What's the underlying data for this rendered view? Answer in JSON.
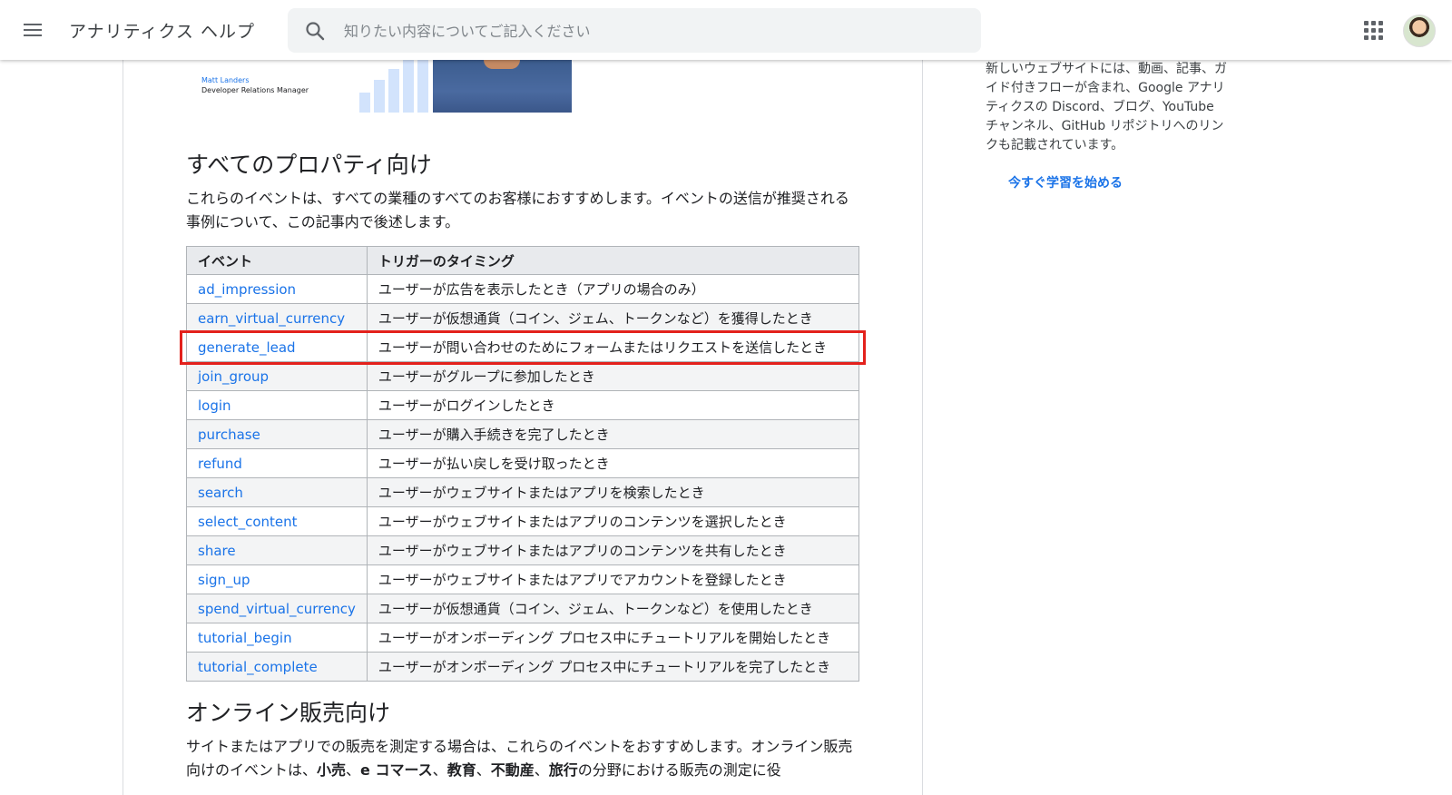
{
  "header": {
    "menu_icon": "menu-icon",
    "title": "アナリティクス ヘルプ",
    "search_placeholder": "知りたい内容についてご記入ください",
    "search_icon": "search-icon",
    "apps_icon": "apps-grid-icon",
    "avatar": "account-avatar"
  },
  "video": {
    "presenter_name": "Matt Landers",
    "presenter_role": "Developer Relations Manager"
  },
  "section_all": {
    "title": "すべてのプロパティ向け",
    "description": "これらのイベントは、すべての業種のすべてのお客様におすすめします。イベントの送信が推奨される事例について、この記事内で後述します。"
  },
  "table": {
    "headers": [
      "イベント",
      "トリガーのタイミング"
    ],
    "rows": [
      {
        "event": "ad_impression",
        "trigger": "ユーザーが広告を表示したとき（アプリの場合のみ）"
      },
      {
        "event": "earn_virtual_currency",
        "trigger": "ユーザーが仮想通貨（コイン、ジェム、トークンなど）を獲得したとき"
      },
      {
        "event": "generate_lead",
        "trigger": "ユーザーが問い合わせのためにフォームまたはリクエストを送信したとき"
      },
      {
        "event": "join_group",
        "trigger": "ユーザーがグループに参加したとき"
      },
      {
        "event": "login",
        "trigger": "ユーザーがログインしたとき"
      },
      {
        "event": "purchase",
        "trigger": "ユーザーが購入手続きを完了したとき"
      },
      {
        "event": "refund",
        "trigger": "ユーザーが払い戻しを受け取ったとき"
      },
      {
        "event": "search",
        "trigger": "ユーザーがウェブサイトまたはアプリを検索したとき"
      },
      {
        "event": "select_content",
        "trigger": "ユーザーがウェブサイトまたはアプリのコンテンツを選択したとき"
      },
      {
        "event": "share",
        "trigger": "ユーザーがウェブサイトまたはアプリのコンテンツを共有したとき"
      },
      {
        "event": "sign_up",
        "trigger": "ユーザーがウェブサイトまたはアプリでアカウントを登録したとき"
      },
      {
        "event": "spend_virtual_currency",
        "trigger": "ユーザーが仮想通貨（コイン、ジェム、トークンなど）を使用したとき"
      },
      {
        "event": "tutorial_begin",
        "trigger": "ユーザーがオンボーディング プロセス中にチュートリアルを開始したとき"
      },
      {
        "event": "tutorial_complete",
        "trigger": "ユーザーがオンボーディング プロセス中にチュートリアルを完了したとき"
      }
    ],
    "highlighted_event": "generate_lead"
  },
  "section_online": {
    "title": "オンライン販売向け",
    "description_part1": "サイトまたはアプリでの販売を測定する場合は、これらのイベントをおすすめします。オンライン販売向けのイベントは、",
    "kw1": "小売",
    "sep1": "、",
    "kw2": "e コマース",
    "sep2": "、",
    "kw3": "教育",
    "sep3": "、",
    "kw4": "不動産",
    "sep4": "、",
    "kw5": "旅行",
    "description_part2": "の分野における販売の測定に役"
  },
  "sidebar": {
    "text": "新しいウェブサイトには、動画、記事、ガイド付きフローが含まれ、Google アナリティクスの Discord、ブログ、YouTube チャンネル、GitHub リポジトリへのリンクも記載されています。",
    "link": "今すぐ学習を始める"
  },
  "colors": {
    "link": "#1a73e8",
    "highlight_border": "#e3211c",
    "header_bg": "#ffffff",
    "search_bg": "#f1f3f4"
  }
}
